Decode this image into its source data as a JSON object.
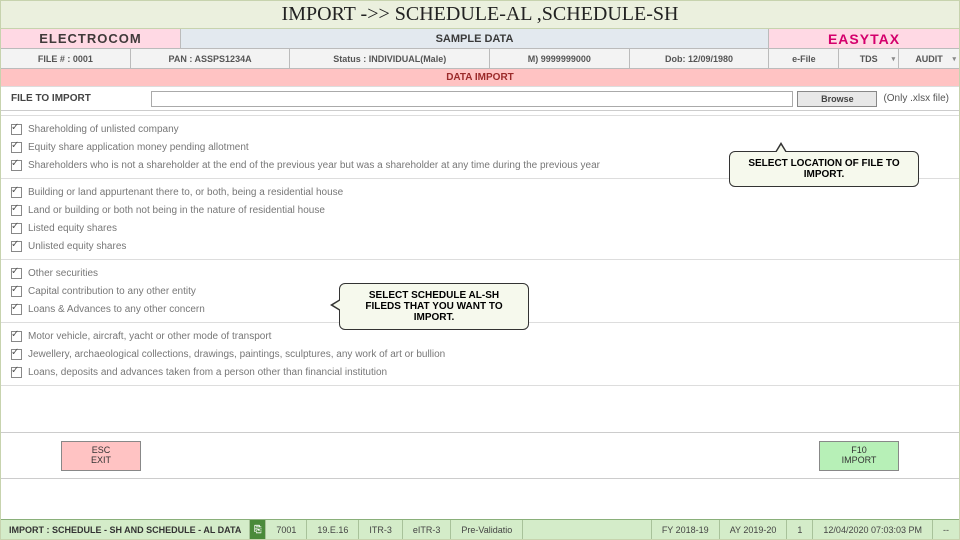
{
  "title": "IMPORT ->> SCHEDULE-AL ,SCHEDULE-SH",
  "brand": {
    "left": "ELECTROCOM",
    "mid": "SAMPLE DATA",
    "right": "EASYTAX"
  },
  "sub": {
    "c1": "FILE # : 0001",
    "c2": "PAN : ASSPS1234A",
    "c3": "Status : INDIVIDUAL(Male)",
    "c4": "M) 9999999000",
    "c5": "Dob: 12/09/1980",
    "c6": "e-File",
    "c7": "TDS",
    "c8": "AUDIT"
  },
  "import_bar": "DATA IMPORT",
  "file_row": {
    "label": "FILE TO IMPORT",
    "value": "",
    "browse": "Browse",
    "hint": "(Only .xlsx file)"
  },
  "callouts": {
    "browse": "SELECT LOCATION OF FILE TO IMPORT.",
    "fields": "SELECT SCHEDULE AL-SH FILEDS THAT YOU WANT TO IMPORT."
  },
  "checks": [
    "Shareholding of unlisted company",
    "Equity share application money pending allotment",
    "Shareholders who is not a shareholder at the end of the previous year but was a shareholder at any time during the previous year",
    "Building or land appurtenant there to, or both, being a residential house",
    "Land or building or both not being in the nature of residential house",
    "Listed equity shares",
    "Unlisted equity shares",
    "Other securities",
    "Capital contribution to any other entity",
    "Loans & Advances to any other concern",
    "Motor vehicle, aircraft, yacht or other mode of transport",
    "Jewellery, archaeological collections, drawings, paintings, sculptures, any work of art or bullion",
    "Loans, deposits and advances taken from a person other than financial institution"
  ],
  "buttons": {
    "esc": "ESC\nEXIT",
    "f10": "F10\nIMPORT"
  },
  "status": {
    "left": "IMPORT : SCHEDULE - SH AND SCHEDULE - AL DATA",
    "cells": [
      "7001",
      "19.E.16",
      "ITR-3",
      "eITR-3",
      "Pre-Validatio",
      "FY 2018-19",
      "AY 2019-20",
      "1",
      "12/04/2020 07:03:03 PM",
      "--"
    ]
  }
}
